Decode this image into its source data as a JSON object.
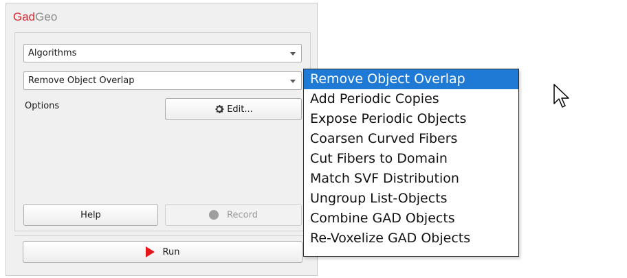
{
  "app": {
    "brand_part1": "Gad",
    "brand_part2": "Geo"
  },
  "algorithms_combo": {
    "value": "Algorithms"
  },
  "algorithm_select": {
    "value": "Remove Object Overlap"
  },
  "options": {
    "label": "Options",
    "edit_button": "Edit..."
  },
  "buttons": {
    "help": "Help",
    "record": "Record",
    "run": "Run"
  },
  "dropdown": {
    "items": [
      "Remove Object Overlap",
      "Add Periodic Copies",
      "Expose Periodic Objects",
      "Coarsen Curved Fibers",
      "Cut Fibers to Domain",
      "Match SVF Distribution",
      "Ungroup List-Objects",
      "Combine GAD Objects",
      "Re-Voxelize GAD Objects"
    ],
    "selected_index": 0
  },
  "colors": {
    "brand_red": "#d8262d",
    "brand_gray": "#8a8a8a",
    "selection": "#1e7ad4",
    "run_icon": "#e3171b"
  },
  "icons": [
    "gear-icon",
    "record-dot-icon",
    "play-icon",
    "mouse-pointer-icon",
    "chevron-down-icon"
  ]
}
